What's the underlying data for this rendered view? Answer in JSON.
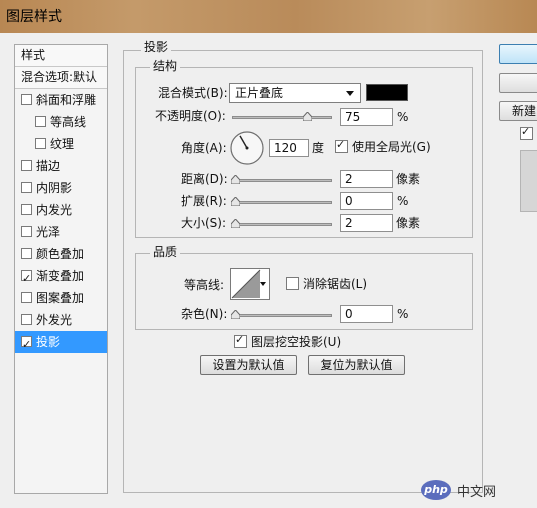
{
  "window": {
    "title": "图层样式"
  },
  "styles_panel": {
    "header": "样式",
    "blend_options": "混合选项:默认",
    "items": [
      {
        "label": "斜面和浮雕",
        "checked": false,
        "indent": false
      },
      {
        "label": "等高线",
        "checked": false,
        "indent": true
      },
      {
        "label": "纹理",
        "checked": false,
        "indent": true
      },
      {
        "label": "描边",
        "checked": false,
        "indent": false
      },
      {
        "label": "内阴影",
        "checked": false,
        "indent": false
      },
      {
        "label": "内发光",
        "checked": false,
        "indent": false
      },
      {
        "label": "光泽",
        "checked": false,
        "indent": false
      },
      {
        "label": "颜色叠加",
        "checked": false,
        "indent": false
      },
      {
        "label": "渐变叠加",
        "checked": true,
        "indent": false
      },
      {
        "label": "图案叠加",
        "checked": false,
        "indent": false
      },
      {
        "label": "外发光",
        "checked": false,
        "indent": false
      },
      {
        "label": "投影",
        "checked": true,
        "indent": false,
        "selected": true
      }
    ]
  },
  "drop_shadow": {
    "title": "投影",
    "structure": {
      "title": "结构",
      "blend_mode_label": "混合模式(B):",
      "blend_mode_value": "正片叠底",
      "shadow_color": "#000000",
      "opacity_label": "不透明度(O):",
      "opacity_value": "75",
      "opacity_unit": "%",
      "opacity_level": 0.75,
      "angle_label": "角度(A):",
      "angle_value": "120",
      "angle_unit": "度",
      "use_global_light_label": "使用全局光(G)",
      "use_global_light_checked": true,
      "distance_label": "距离(D):",
      "distance_value": "2",
      "distance_unit": "像素",
      "spread_label": "扩展(R):",
      "spread_value": "0",
      "spread_unit": "%",
      "size_label": "大小(S):",
      "size_value": "2",
      "size_unit": "像素"
    },
    "quality": {
      "title": "品质",
      "contour_label": "等高线:",
      "anti_alias_label": "消除锯齿(L)",
      "anti_alias_checked": false,
      "noise_label": "杂色(N):",
      "noise_value": "0",
      "noise_unit": "%"
    },
    "knockout_label": "图层挖空投影(U)",
    "knockout_checked": true,
    "make_default_label": "设置为默认值",
    "reset_default_label": "复位为默认值"
  },
  "right_panel": {
    "new_style_label": "新建"
  },
  "colors": {
    "selection": "#3399ff",
    "window_bg": "#efefef"
  },
  "watermark": {
    "brand": "php",
    "site": "中文网"
  }
}
